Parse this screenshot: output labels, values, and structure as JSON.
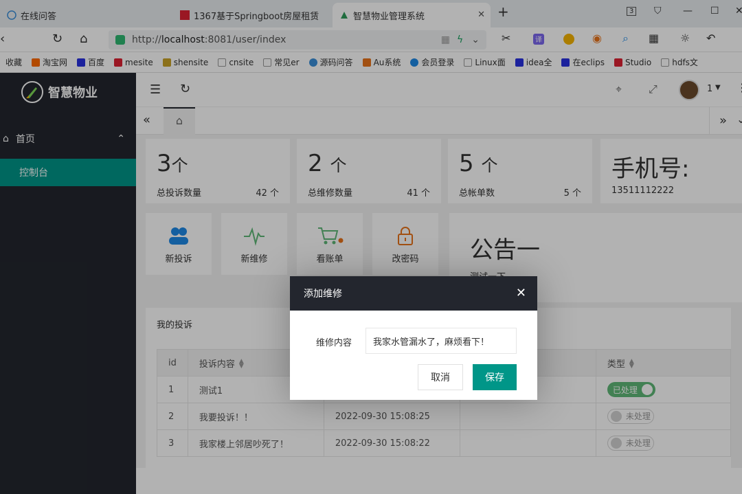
{
  "browser": {
    "tabs": [
      {
        "label": "在线问答"
      },
      {
        "label": "1367基于Springboot房屋租赁"
      },
      {
        "label": "智慧物业管理系统"
      }
    ],
    "url_prefix": "http://",
    "url_host": "localhost",
    "url_rest": ":8081/user/index",
    "tab_counter": "3",
    "profile_count": "1",
    "bookmarks": [
      "收藏",
      "淘宝网",
      "百度",
      "mesite",
      "shensite",
      "cnsite",
      "常见er",
      "源码问答",
      "Au系统",
      "会员登录",
      "Linux面",
      "idea全",
      "在eclips",
      "Studio",
      "hdfs文"
    ]
  },
  "sidebar": {
    "logo_text": "智慧物业",
    "menu_home": "首页",
    "menu_dashboard": "控制台"
  },
  "stats": [
    {
      "big": "3",
      "unit": "个",
      "label": "总投诉数量",
      "value": "42 个"
    },
    {
      "big": "2",
      "unit": "个",
      "label": "总维修数量",
      "value": "41 个"
    },
    {
      "big": "5",
      "unit": "个",
      "label": "总帐单数",
      "value": "5 个"
    },
    {
      "big": "手机号:",
      "unit": "",
      "label": "13511112222",
      "value": ""
    }
  ],
  "quick_actions": [
    {
      "label": "新投诉",
      "icon": "users-icon"
    },
    {
      "label": "新维修",
      "icon": "pulse-icon"
    },
    {
      "label": "看账单",
      "icon": "cart-icon"
    },
    {
      "label": "改密码",
      "icon": "lock-icon"
    }
  ],
  "notice": {
    "title": "公告一",
    "body": "测试一下"
  },
  "complaints": {
    "title": "我的投诉",
    "columns": [
      "id",
      "投诉内容",
      "",
      "",
      "类型"
    ],
    "rows": [
      {
        "id": "1",
        "content": "测试1",
        "time": "",
        "status": "已处理",
        "done": true
      },
      {
        "id": "2",
        "content": "我要投诉！！",
        "time": "2022-09-30 15:08:25",
        "status": "未处理",
        "done": false
      },
      {
        "id": "3",
        "content": "我家楼上邻居吵死了！",
        "time": "2022-09-30 15:08:22",
        "status": "未处理",
        "done": false
      }
    ]
  },
  "modal": {
    "title": "添加维修",
    "field_label": "维修内容",
    "field_value": "我家水管漏水了，麻烦看下！",
    "cancel": "取消",
    "save": "保存"
  },
  "colors": {
    "primary": "#009688",
    "sidebar": "#23262e",
    "switch_on": "#5fb878"
  }
}
